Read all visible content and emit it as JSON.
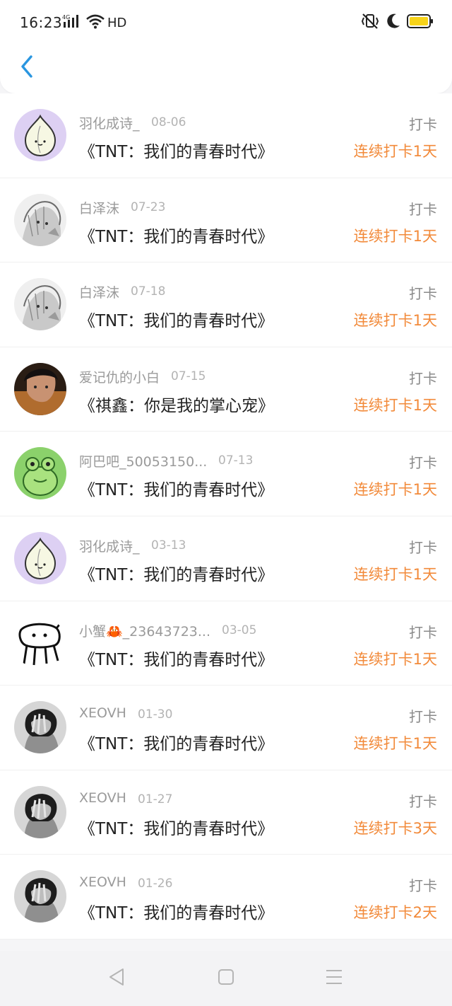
{
  "status_bar": {
    "time": "16:23",
    "network": "4G",
    "hd": "HD",
    "icons": [
      "signal-icon",
      "wifi-icon",
      "vibrate-icon",
      "moon-icon",
      "battery-icon"
    ]
  },
  "header": {
    "back_icon": "chevron-left-icon",
    "accent": "#2a96e0"
  },
  "colors": {
    "streak": "#f28a3a",
    "name": "#9a9a9a",
    "title": "#222222"
  },
  "records": [
    {
      "user": "羽化成诗_",
      "date": "08-06",
      "title": "《TNT：我们的青春时代》",
      "action": "打卡",
      "streak": "连续打卡1天",
      "avatar": "garlic"
    },
    {
      "user": "白泽沫",
      "date": "07-23",
      "title": "《TNT：我们的青春时代》",
      "action": "打卡",
      "streak": "连续打卡1天",
      "avatar": "sketch"
    },
    {
      "user": "白泽沫",
      "date": "07-18",
      "title": "《TNT：我们的青春时代》",
      "action": "打卡",
      "streak": "连续打卡1天",
      "avatar": "sketch"
    },
    {
      "user": "爱记仇的小白",
      "date": "07-15",
      "title": "《祺鑫：你是我的掌心宠》",
      "action": "打卡",
      "streak": "连续打卡1天",
      "avatar": "photo"
    },
    {
      "user": "阿巴吧_50053150...",
      "date": "07-13",
      "title": "《TNT：我们的青春时代》",
      "action": "打卡",
      "streak": "连续打卡1天",
      "avatar": "frog"
    },
    {
      "user": "羽化成诗_",
      "date": "03-13",
      "title": "《TNT：我们的青春时代》",
      "action": "打卡",
      "streak": "连续打卡1天",
      "avatar": "garlic"
    },
    {
      "user": "小蟹🦀_23643723...",
      "date": "03-05",
      "title": "《TNT：我们的青春时代》",
      "action": "打卡",
      "streak": "连续打卡1天",
      "avatar": "doodle"
    },
    {
      "user": "XEOVH",
      "date": "01-30",
      "title": "《TNT：我们的青春时代》",
      "action": "打卡",
      "streak": "连续打卡1天",
      "avatar": "bw"
    },
    {
      "user": "XEOVH",
      "date": "01-27",
      "title": "《TNT：我们的青春时代》",
      "action": "打卡",
      "streak": "连续打卡3天",
      "avatar": "bw"
    },
    {
      "user": "XEOVH",
      "date": "01-26",
      "title": "《TNT：我们的青春时代》",
      "action": "打卡",
      "streak": "连续打卡2天",
      "avatar": "bw"
    }
  ],
  "nav_bar": {
    "icons": [
      "back-triangle-icon",
      "home-square-icon",
      "menu-lines-icon"
    ]
  }
}
